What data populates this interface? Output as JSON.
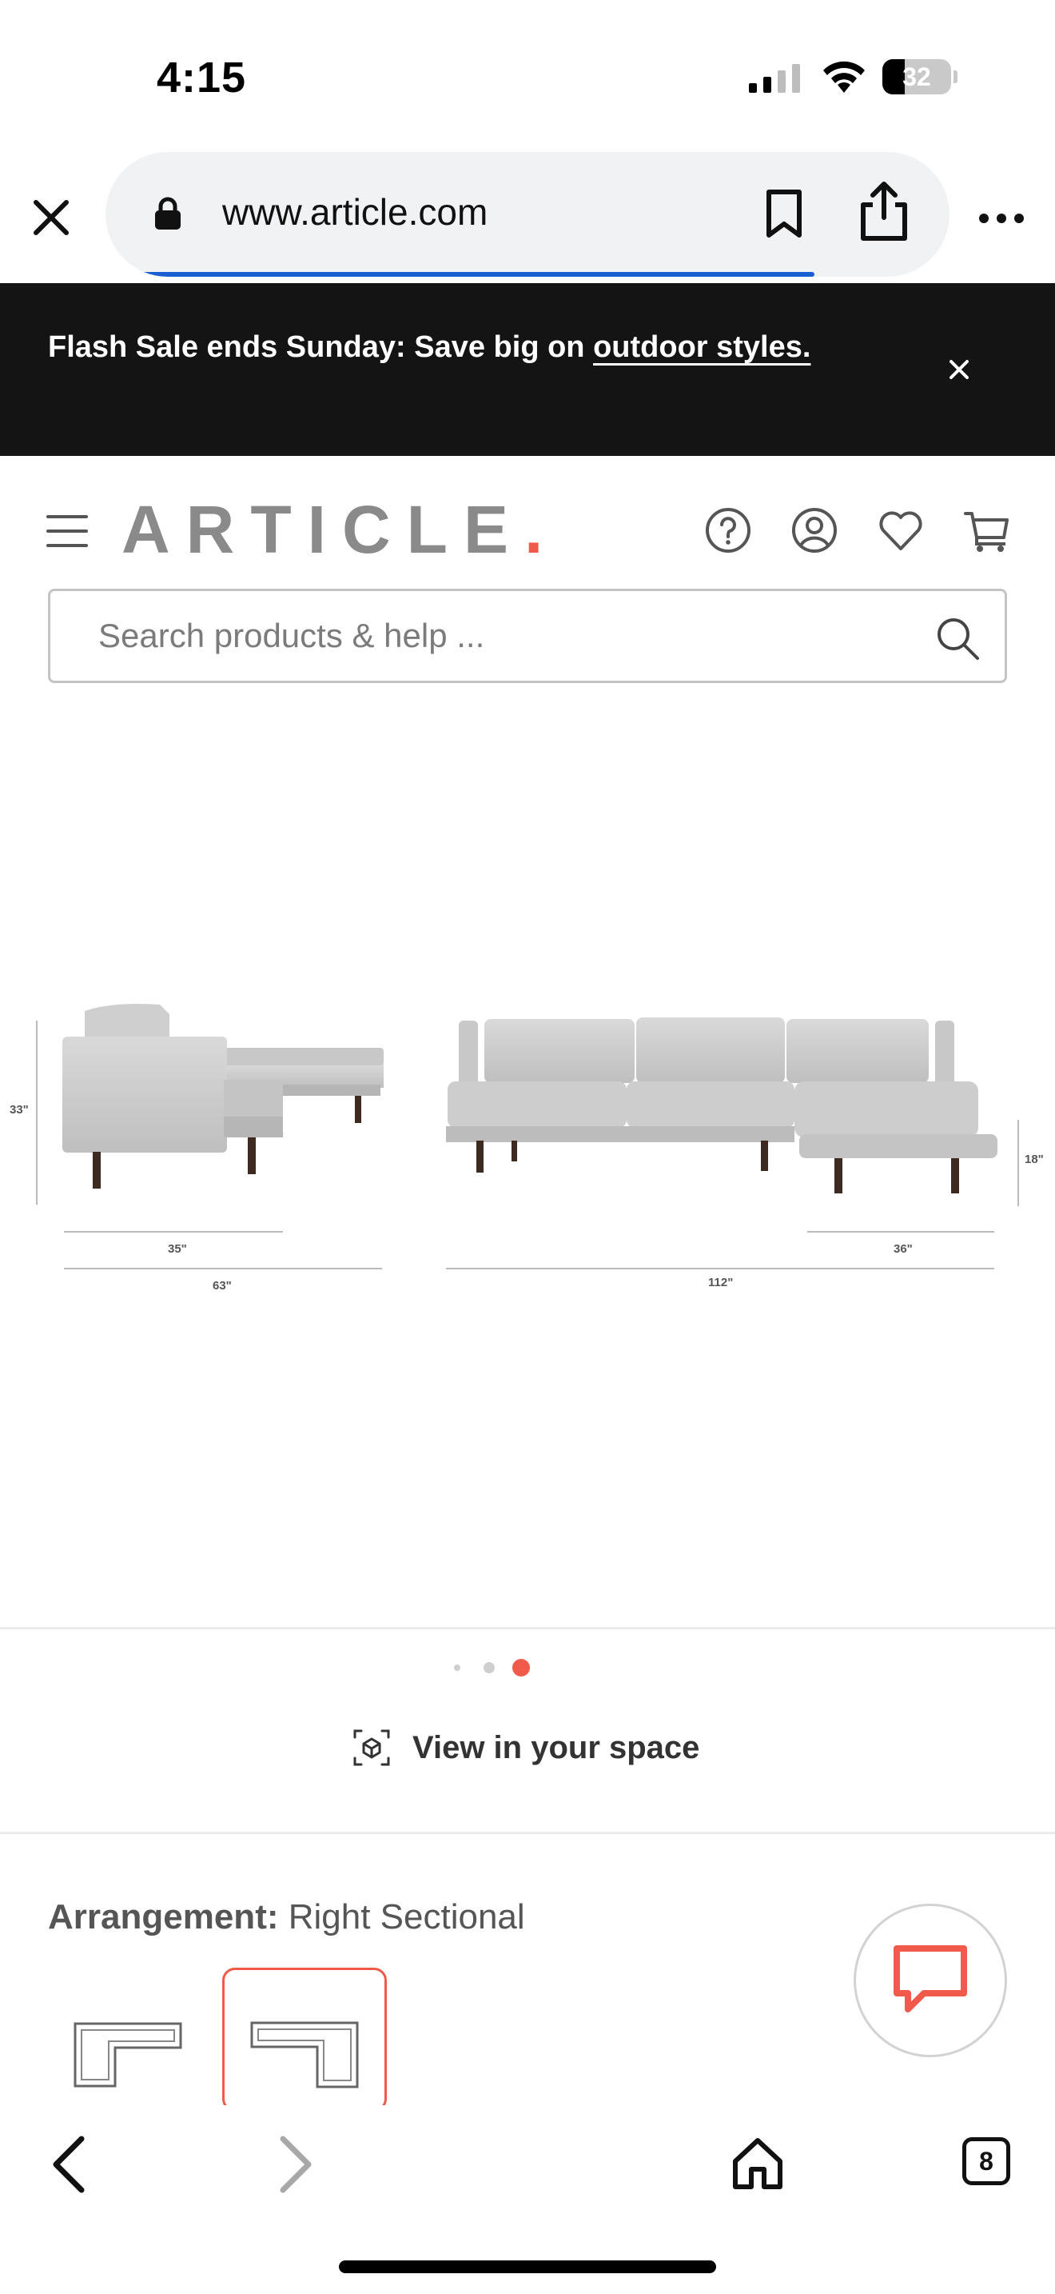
{
  "status_bar": {
    "time": "4:15",
    "battery_level": "32",
    "icons": [
      "signal-icon",
      "wifi-icon",
      "battery-icon"
    ]
  },
  "browser": {
    "url": "www.article.com",
    "tabs_count": "8",
    "load_progress_percent": 84,
    "icons": [
      "close-icon",
      "lock-icon",
      "bookmark-icon",
      "share-icon",
      "more-icon",
      "back-icon",
      "forward-icon",
      "home-icon"
    ]
  },
  "promo": {
    "text": "Flash Sale ends Sunday: Save big on ",
    "link": "outdoor styles."
  },
  "header": {
    "logo": "ARTICLE",
    "logo_dot": ".",
    "icons": [
      "menu-icon",
      "help-icon",
      "account-icon",
      "wishlist-icon",
      "cart-icon"
    ]
  },
  "search": {
    "placeholder": "Search products & help ..."
  },
  "product_image": {
    "dimensions": {
      "height": "33\"",
      "seat_depth": "35\"",
      "depth": "63\"",
      "chaise_width": "36\"",
      "width": "112\"",
      "seat_height": "18\""
    }
  },
  "carousel": {
    "total": 3,
    "active_index": 2
  },
  "view_in_space": {
    "label": "View in your space"
  },
  "arrangement": {
    "key": "Arrangement:",
    "value": "Right Sectional",
    "selected_index": 1
  },
  "colors": {
    "brand_accent": "#f05a4a",
    "promo_bg": "#141414",
    "progress_blue": "#1a5fd1"
  }
}
